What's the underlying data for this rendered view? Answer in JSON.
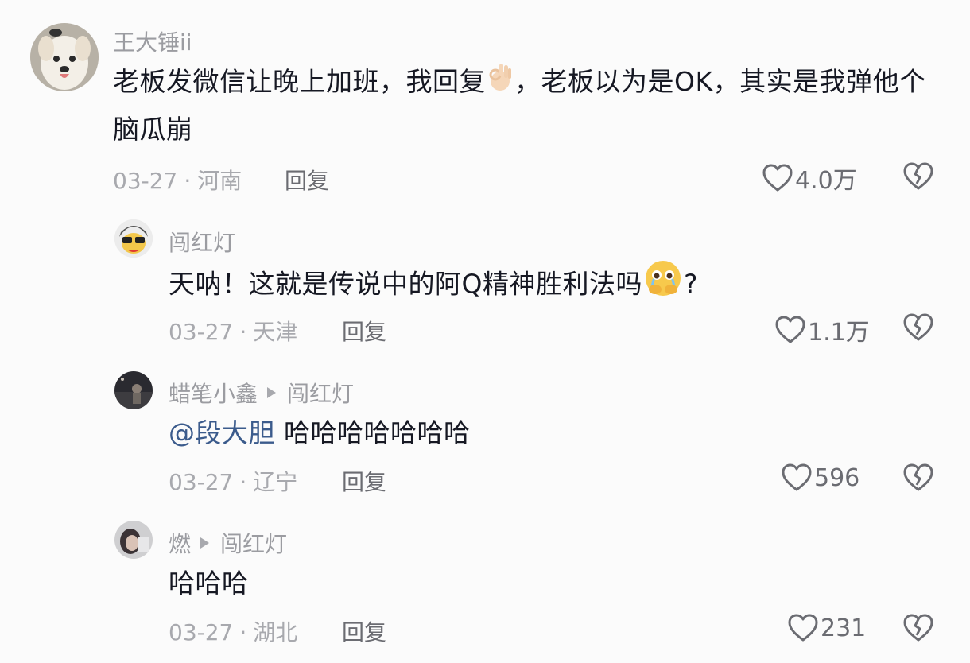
{
  "comments": [
    {
      "user": "王大锤ii",
      "text_before": "老板发微信让晚上加班，我回复",
      "text_after": "，老板以为是OK，其实是我弹他个脑瓜崩",
      "date": "03-27",
      "location": "河南",
      "reply_label": "回复",
      "likes": "4.0万"
    },
    {
      "user": "闯红灯",
      "text_before": "天呐！这就是传说中的阿Q精神胜利法吗",
      "text_after": "?",
      "date": "03-27",
      "location": "天津",
      "reply_label": "回复",
      "likes": "1.1万"
    },
    {
      "user": "蜡笔小鑫",
      "reply_to": "闯红灯",
      "mention": "@段大胆",
      "text": " 哈哈哈哈哈哈哈",
      "date": "03-27",
      "location": "辽宁",
      "reply_label": "回复",
      "likes": "596"
    },
    {
      "user": "燃",
      "reply_to": "闯红灯",
      "text": "哈哈哈",
      "date": "03-27",
      "location": "湖北",
      "reply_label": "回复",
      "likes": "231"
    }
  ],
  "icons": {
    "like": "heart-outline-icon",
    "dislike": "broken-heart-icon",
    "arrow": "reply-arrow-icon"
  },
  "colors": {
    "mention": "#3b5b8c",
    "meta": "#a8a9ae",
    "background": "#fbfbfb"
  }
}
